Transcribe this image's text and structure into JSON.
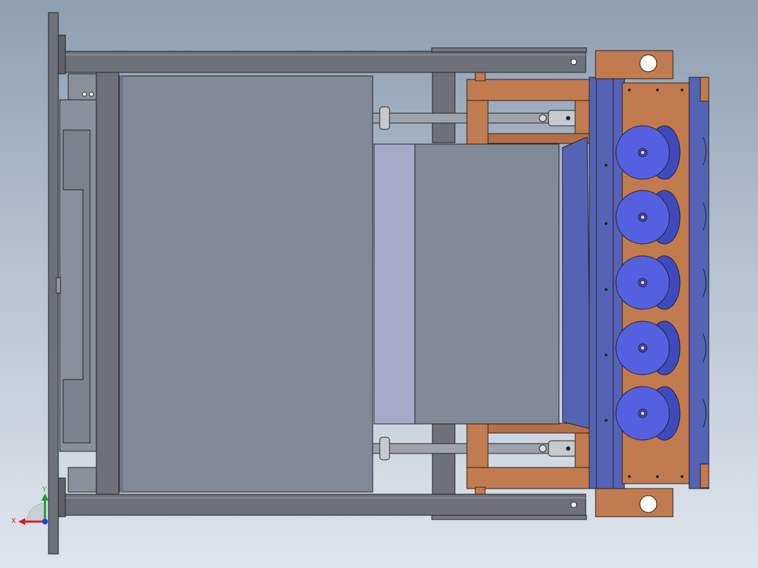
{
  "app": {
    "title": ""
  },
  "viewport": {
    "background_top": "#8e9fb2",
    "background_bottom": "#dfe5ec",
    "view": "top view",
    "model_colors": {
      "frame_gray": "#6e7179",
      "panel_gray": "#818898",
      "copper": "#c27a4f",
      "blue": "#5563b5",
      "roller_blue": "#4d5ad8"
    }
  },
  "triad": {
    "x_label": "X",
    "y_label": "Y",
    "x_color": "#d21f1f",
    "y_color": "#1c9b2c",
    "z_color": "#1f3fd2"
  },
  "model": {
    "roller_count": 5
  }
}
